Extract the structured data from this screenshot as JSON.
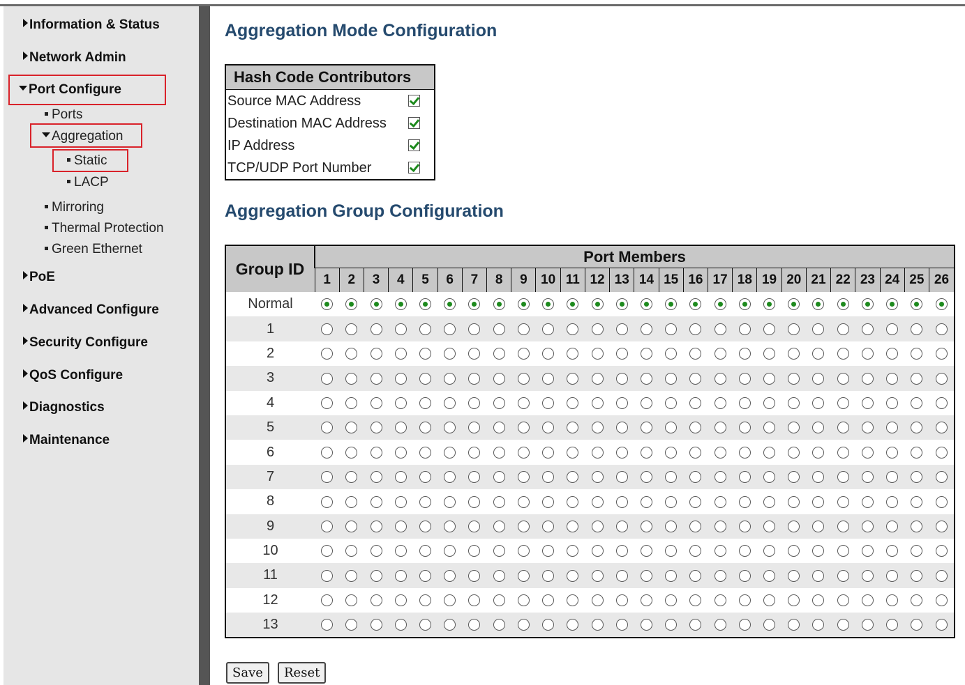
{
  "nav": {
    "top_items": [
      "Information & Status",
      "Network Admin",
      "Port Configure",
      "PoE",
      "Advanced Configure",
      "Security Configure",
      "QoS Configure",
      "Diagnostics",
      "Maintenance"
    ],
    "port_configure_children": {
      "ports": "Ports",
      "aggregation": "Aggregation",
      "aggregation_children": [
        "Static",
        "LACP"
      ],
      "others": [
        "Mirroring",
        "Thermal Protection",
        "Green Ethernet"
      ]
    }
  },
  "mode_config": {
    "title": "Aggregation Mode Configuration",
    "table_header": "Hash Code Contributors",
    "rows": [
      {
        "label": "Source MAC Address",
        "checked": true
      },
      {
        "label": "Destination MAC Address",
        "checked": true
      },
      {
        "label": "IP Address",
        "checked": true
      },
      {
        "label": "TCP/UDP Port Number",
        "checked": true
      }
    ]
  },
  "group_config": {
    "title": "Aggregation Group Configuration",
    "group_id_header": "Group ID",
    "port_members_header": "Port Members",
    "ports": [
      "1",
      "2",
      "3",
      "4",
      "5",
      "6",
      "7",
      "8",
      "9",
      "10",
      "11",
      "12",
      "13",
      "14",
      "15",
      "16",
      "17",
      "18",
      "19",
      "20",
      "21",
      "22",
      "23",
      "24",
      "25",
      "26"
    ],
    "groups": [
      "Normal",
      "1",
      "2",
      "3",
      "4",
      "5",
      "6",
      "7",
      "8",
      "9",
      "10",
      "11",
      "12",
      "13"
    ],
    "selected_group": "Normal"
  },
  "buttons": {
    "save": "Save",
    "reset": "Reset"
  },
  "colors": {
    "heading": "#254a6e",
    "highlight": "#d9222a",
    "radio_selected": "#1d8a1d"
  }
}
